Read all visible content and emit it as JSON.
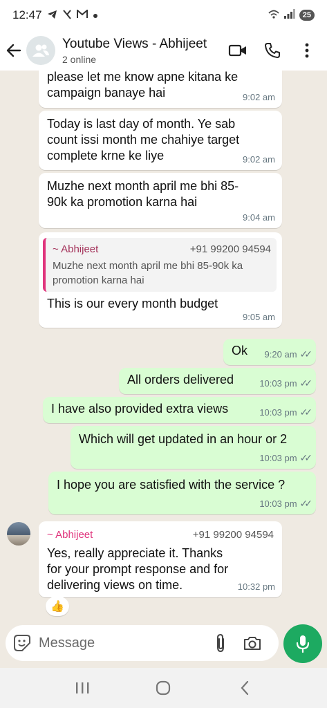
{
  "status_bar": {
    "time": "12:47",
    "icons_left": [
      "telegram-icon",
      "tiktok-icon",
      "gmail-icon",
      "dot-icon"
    ],
    "icons_right": [
      "alarm-icon",
      "signal-icon"
    ],
    "battery": "25"
  },
  "header": {
    "title": "Youtube Views - Abhijeet",
    "subtitle": "2 online",
    "icons": [
      "back-arrow-icon",
      "group-avatar-icon",
      "video-call-icon",
      "phone-icon",
      "more-options-icon"
    ]
  },
  "messages": [
    {
      "direction": "in",
      "text": "please let me know apne kitana ke campaign banaye hai",
      "time": "9:02 am"
    },
    {
      "direction": "in",
      "text": "Today is last day of month. Ye sab count issi month me chahiye target complete krne ke liye",
      "time": "9:02 am"
    },
    {
      "direction": "in",
      "text": "Muzhe next month april me bhi 85-90k ka promotion karna hai",
      "time": "9:04 am"
    },
    {
      "direction": "in",
      "quote": {
        "author": "~ Abhijeet",
        "phone": "+91 99200 94594",
        "text": "Muzhe next month april me bhi 85-90k ka promotion karna hai"
      },
      "text": "This is our every month budget",
      "time": "9:05 am"
    },
    {
      "direction": "out",
      "text": "Ok",
      "time": "9:20 am",
      "ticks": "✓✓"
    },
    {
      "direction": "out",
      "text": "All orders delivered",
      "time": "10:03 pm",
      "ticks": "✓✓"
    },
    {
      "direction": "out",
      "text": "I have also provided extra views",
      "time": "10:03 pm",
      "ticks": "✓✓"
    },
    {
      "direction": "out",
      "text": "Which will get updated in an hour or 2",
      "time": "10:03 pm",
      "ticks": "✓✓"
    },
    {
      "direction": "out",
      "text": "I hope you are satisfied with the service ?",
      "time": "10:03 pm",
      "ticks": "✓✓"
    },
    {
      "direction": "in",
      "sender": "~ Abhijeet",
      "phone": "+91 99200 94594",
      "text": "Yes, really appreciate it. Thanks for your prompt response and for delivering views on time.",
      "time": "10:32 pm",
      "reaction": "👍"
    }
  ],
  "input": {
    "placeholder": "Message",
    "value": ""
  },
  "colors": {
    "outgoing_bubble": "#d9fdd3",
    "accent_green": "#1daa61",
    "quote_bar": "#e0357d",
    "chat_bg": "#efeae2"
  }
}
